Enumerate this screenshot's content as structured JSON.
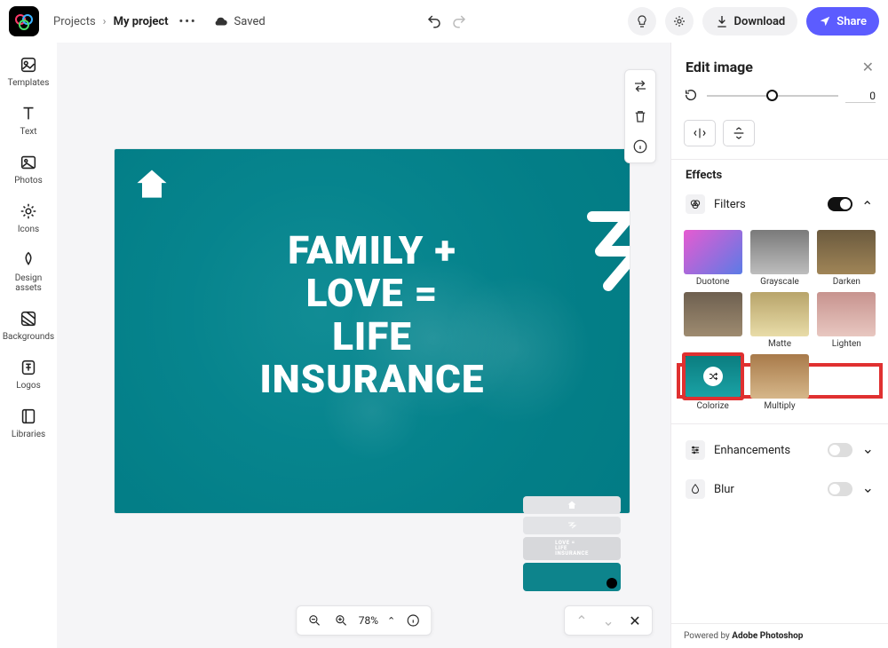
{
  "breadcrumbs": {
    "root": "Projects",
    "project": "My project"
  },
  "saved_label": "Saved",
  "topbar": {
    "download": "Download",
    "share": "Share"
  },
  "left_rail": [
    {
      "label": "Templates"
    },
    {
      "label": "Text"
    },
    {
      "label": "Photos"
    },
    {
      "label": "Icons"
    },
    {
      "label": "Design assets"
    },
    {
      "label": "Backgrounds"
    },
    {
      "label": "Logos"
    },
    {
      "label": "Libraries"
    }
  ],
  "canvas": {
    "headline": [
      "FAMILY +",
      "LOVE =",
      "LIFE",
      "INSURANCE"
    ]
  },
  "zoom": {
    "percent": "78%"
  },
  "right_panel": {
    "title": "Edit image",
    "slider_value": "0",
    "effects_title": "Effects",
    "filters": {
      "label": "Filters",
      "enabled": true,
      "items": [
        {
          "label": "Duotone",
          "cls": "ft-duotone"
        },
        {
          "label": "Grayscale",
          "cls": "ft-gray"
        },
        {
          "label": "Darken",
          "cls": "ft-darken"
        },
        {
          "label": "",
          "cls": "ft-row2a"
        },
        {
          "label": "Matte",
          "cls": "ft-matte"
        },
        {
          "label": "Lighten",
          "cls": "ft-lighten"
        },
        {
          "label": "Colorize",
          "cls": "ft-colorize",
          "selected": true,
          "shuffle": true
        },
        {
          "label": "Multiply",
          "cls": "ft-multiply"
        }
      ]
    },
    "enhancements": {
      "label": "Enhancements",
      "enabled": false
    },
    "blur": {
      "label": "Blur",
      "enabled": false
    },
    "footer": {
      "prefix": "Powered by ",
      "brand": "Adobe Photoshop"
    }
  }
}
